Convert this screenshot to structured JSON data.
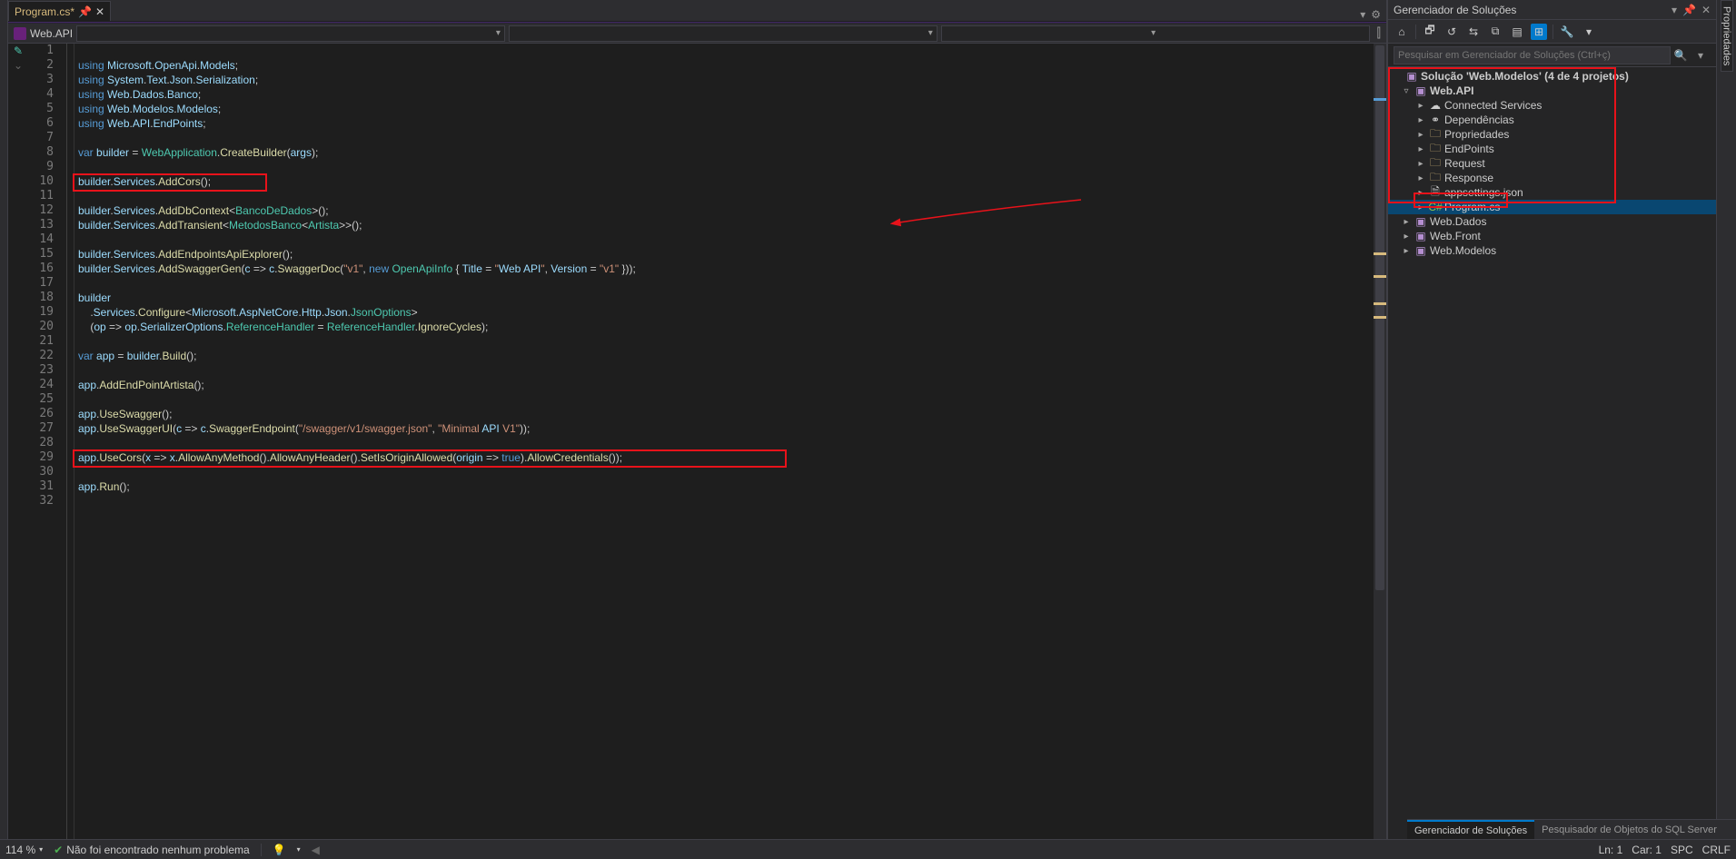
{
  "tab": {
    "label": "Program.cs*",
    "pin_icon": "pin-icon",
    "close_icon": "close-icon"
  },
  "tabbar_right": {
    "dropdown_icon": "chevron-down",
    "gear_icon": "gear"
  },
  "navcontext": {
    "project": "Web.API"
  },
  "solution_panel": {
    "title": "Gerenciador de Soluções",
    "window_icons": [
      "chevron-down",
      "pin",
      "close"
    ],
    "search_placeholder": "Pesquisar em Gerenciador de Soluções (Ctrl+ç)"
  },
  "tree": {
    "root": "Solução 'Web.Modelos' (4 de 4 projetos)",
    "webapi": "Web.API",
    "items": [
      "Connected Services",
      "Dependências",
      "Propriedades",
      "EndPoints",
      "Request",
      "Response",
      "appsettings.json",
      "Program.cs"
    ],
    "other_projects": [
      "Web.Dados",
      "Web.Front",
      "Web.Modelos"
    ]
  },
  "far_right_tab": "Propriedades",
  "bottom_tabs": {
    "active": "Gerenciador de Soluções",
    "other": "Pesquisador de Objetos do SQL Server"
  },
  "statusbar": {
    "zoom": "114 %",
    "problems": "Não foi encontrado nenhum problema",
    "ln": "Ln: 1",
    "car": "Car: 1",
    "spc": "SPC",
    "crlf": "CRLF"
  },
  "code_lines": [
    "",
    "using Microsoft.OpenApi.Models;",
    "using System.Text.Json.Serialization;",
    "using Web.Dados.Banco;",
    "using Web.Modelos.Modelos;",
    "using Web.API.EndPoints;",
    "",
    "var builder = WebApplication.CreateBuilder(args);",
    "",
    "builder.Services.AddCors();",
    "",
    "builder.Services.AddDbContext<BancoDeDados>();",
    "builder.Services.AddTransient<MetodosBanco<Artista>>();",
    "",
    "builder.Services.AddEndpointsApiExplorer();",
    "builder.Services.AddSwaggerGen(c => c.SwaggerDoc(\"v1\", new OpenApiInfo { Title = \"Web API\", Version = \"v1\" }));",
    "",
    "builder",
    "    .Services.Configure<Microsoft.AspNetCore.Http.Json.JsonOptions>",
    "    (op => op.SerializerOptions.ReferenceHandler = ReferenceHandler.IgnoreCycles);",
    "",
    "var app = builder.Build();",
    "",
    "app.AddEndPointArtista();",
    "",
    "app.UseSwagger();",
    "app.UseSwaggerUI(c => c.SwaggerEndpoint(\"/swagger/v1/swagger.json\", \"Minimal API V1\"));",
    "",
    "app.UseCors(x => x.AllowAnyMethod().AllowAnyHeader().SetIsOriginAllowed(origin => true).AllowCredentials());",
    "",
    "app.Run();",
    ""
  ]
}
